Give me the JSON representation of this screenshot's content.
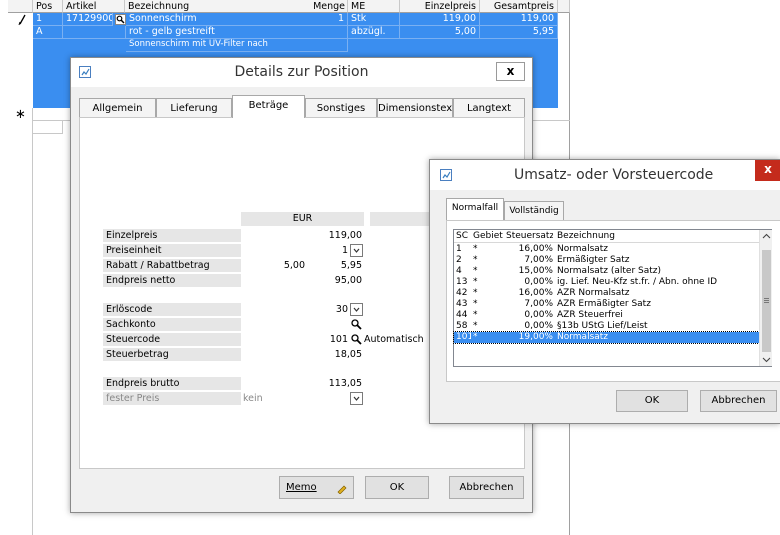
{
  "grid": {
    "headers": {
      "pos": "Pos",
      "artikel": "Artikel",
      "bezeichnung": "Bezeichnung",
      "menge": "Menge",
      "me": "ME",
      "einzelpreis": "Einzelpreis",
      "gesamtpreis": "Gesamtpreis"
    },
    "row1": {
      "pos": "1",
      "artikel": "17129900",
      "bezeichnung": "Sonnenschirm",
      "menge": "1",
      "me": "Stk",
      "einzelpreis": "119,00",
      "gesamtpreis": "119,00"
    },
    "row2": {
      "pos": "A",
      "bezeichnung": "rot - gelb gestreift",
      "me": "abzügl.",
      "einzelpreis": "5,00",
      "gesamtpreis": "5,95"
    },
    "row3": {
      "bezeichnung": "Sonnenschirm mit UV-Filter nach"
    }
  },
  "details_dialog": {
    "title": "Details zur Position",
    "tabs": [
      "Allgemein",
      "Lieferung",
      "Beträge",
      "Sonstiges",
      "Dimensionstext",
      "Langtext"
    ],
    "currency_header": "EUR",
    "fields": {
      "einzelpreis_label": "Einzelpreis",
      "einzelpreis_value": "119,00",
      "preiseinheit_label": "Preiseinheit",
      "preiseinheit_value": "1",
      "rabatt_label": "Rabatt / Rabattbetrag",
      "rabatt_percent": "5,00",
      "rabatt_value": "5,95",
      "endpreis_netto_label": "Endpreis netto",
      "endpreis_netto_value": "95,00",
      "erloescode_label": "Erlöscode",
      "erloescode_value": "30",
      "sachkonto_label": "Sachkonto",
      "steuercode_label": "Steuercode",
      "steuercode_value": "101",
      "steuercode_extra": "Automatisch",
      "steuerbetrag_label": "Steuerbetrag",
      "steuerbetrag_value": "18,05",
      "endpreis_brutto_label": "Endpreis brutto",
      "endpreis_brutto_value": "113,05",
      "fester_preis_label": "fester Preis",
      "fester_preis_value": "kein"
    },
    "buttons": {
      "memo": "Memo",
      "ok": "OK",
      "abbrechen": "Abbrechen"
    }
  },
  "code_dialog": {
    "title": "Umsatz- oder Vorsteuercode",
    "tabs": [
      "Normalfall",
      "Vollständig"
    ],
    "columns": {
      "sc": "SC",
      "gebiet": "Gebiet",
      "steuersatz": "Steuersatz",
      "bezeichnung": "Bezeichnung"
    },
    "rows": [
      {
        "sc": "1",
        "gebiet": "*",
        "steuersatz": "16,00%",
        "bezeichnung": "Normalsatz"
      },
      {
        "sc": "2",
        "gebiet": "*",
        "steuersatz": "7,00%",
        "bezeichnung": "Ermäßigter Satz"
      },
      {
        "sc": "4",
        "gebiet": "*",
        "steuersatz": "15,00%",
        "bezeichnung": "Normalsatz (alter Satz)"
      },
      {
        "sc": "13",
        "gebiet": "*",
        "steuersatz": "0,00%",
        "bezeichnung": "ig. Lief. Neu-Kfz st.fr. / Abn. ohne ID"
      },
      {
        "sc": "42",
        "gebiet": "*",
        "steuersatz": "16,00%",
        "bezeichnung": "AZR Normalsatz"
      },
      {
        "sc": "43",
        "gebiet": "*",
        "steuersatz": "7,00%",
        "bezeichnung": "AZR Ermäßigter Satz"
      },
      {
        "sc": "44",
        "gebiet": "*",
        "steuersatz": "0,00%",
        "bezeichnung": "AZR Steuerfrei"
      },
      {
        "sc": "58",
        "gebiet": "*",
        "steuersatz": "0,00%",
        "bezeichnung": "§13b UStG Lief/Leist"
      },
      {
        "sc": "101",
        "gebiet": "*",
        "steuersatz": "19,00%",
        "bezeichnung": "Normalsatz"
      }
    ],
    "selected_row": "101",
    "buttons": {
      "ok": "OK",
      "abbrechen": "Abbrechen"
    }
  },
  "colors": {
    "selection": "#3a8ef0",
    "close_red": "#c42b1c"
  }
}
